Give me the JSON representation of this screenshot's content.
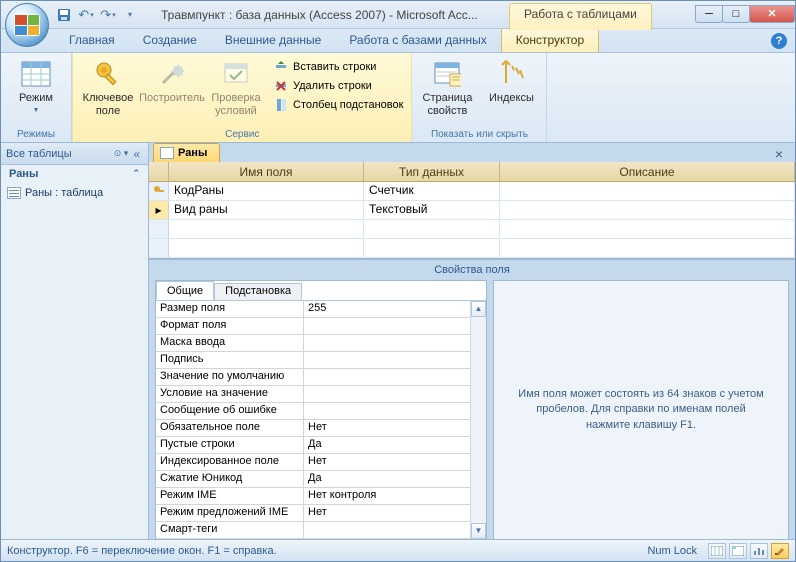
{
  "title": "Травмпункт : база данных (Access 2007) - Microsoft Acc...",
  "context_tab": "Работа с таблицами",
  "ribbon_tabs": [
    "Главная",
    "Создание",
    "Внешние данные",
    "Работа с базами данных",
    "Конструктор"
  ],
  "ribbon": {
    "view": {
      "label": "Режим",
      "group": "Режимы"
    },
    "key": {
      "label": "Ключевое поле"
    },
    "builder": {
      "label": "Построитель"
    },
    "test": {
      "label": "Проверка условий"
    },
    "service_group": "Сервис",
    "insert_rows": "Вставить строки",
    "delete_rows": "Удалить строки",
    "lookup_col": "Столбец подстановок",
    "prop_sheet": {
      "label": "Страница свойств"
    },
    "indexes": {
      "label": "Индексы"
    },
    "showhide_group": "Показать или скрыть"
  },
  "navpane": {
    "header": "Все таблицы",
    "group": "Раны",
    "item": "Раны : таблица"
  },
  "object_tab": "Раны",
  "grid": {
    "headers": {
      "name": "Имя поля",
      "type": "Тип данных",
      "desc": "Описание"
    },
    "rows": [
      {
        "name": "КодРаны",
        "type": "Счетчик",
        "pk": true
      },
      {
        "name": "Вид раны",
        "type": "Текстовый",
        "pk": false,
        "current": true
      }
    ]
  },
  "props_title": "Свойства поля",
  "prop_tabs": {
    "general": "Общие",
    "lookup": "Подстановка"
  },
  "properties": [
    {
      "n": "Размер поля",
      "v": "255"
    },
    {
      "n": "Формат поля",
      "v": ""
    },
    {
      "n": "Маска ввода",
      "v": ""
    },
    {
      "n": "Подпись",
      "v": ""
    },
    {
      "n": "Значение по умолчанию",
      "v": ""
    },
    {
      "n": "Условие на значение",
      "v": ""
    },
    {
      "n": "Сообщение об ошибке",
      "v": ""
    },
    {
      "n": "Обязательное поле",
      "v": "Нет"
    },
    {
      "n": "Пустые строки",
      "v": "Да"
    },
    {
      "n": "Индексированное поле",
      "v": "Нет"
    },
    {
      "n": "Сжатие Юникод",
      "v": "Да"
    },
    {
      "n": "Режим IME",
      "v": "Нет контроля"
    },
    {
      "n": "Режим предложений IME",
      "v": "Нет"
    },
    {
      "n": "Смарт-теги",
      "v": ""
    }
  ],
  "help_text": "Имя поля может состоять из 64 знаков с учетом пробелов.  Для справки по именам полей нажмите клавишу F1.",
  "status_left": "Конструктор.  F6 = переключение окон.  F1 = справка.",
  "status_right": "Num Lock"
}
